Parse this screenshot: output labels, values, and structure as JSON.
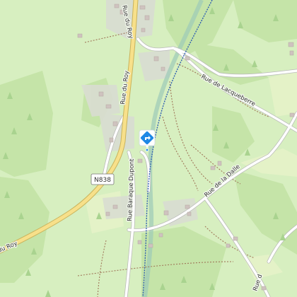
{
  "map": {
    "roads": [
      {
        "id": "rue-du-roy-north",
        "label": "Rue du Roy"
      },
      {
        "id": "rue-du-roy-south",
        "label": "du Roy"
      },
      {
        "id": "rue-de-lacqueberre",
        "label": "Rue de Lacqueberre"
      },
      {
        "id": "rue-de-la-dalle",
        "label": "Rue de la Dalle"
      },
      {
        "id": "rue-baraque-dupont",
        "label": "Rue Baraque Dupont"
      },
      {
        "id": "rue-d-east",
        "label": "Rue d"
      }
    ],
    "route_shield": {
      "label": "N838"
    },
    "marker": {
      "icon": "directions-diamond-icon",
      "color": "#1e88e5"
    },
    "colors": {
      "background": "#d7efc0",
      "forest": "#c6e5ab",
      "meadow": "#e6f3c8",
      "major_road": "#f7e08a",
      "major_road_casing": "#c9b35c",
      "minor_road": "#ffffff",
      "railway": "#2f5fb0",
      "path": "#a0785a",
      "building": "#d4c9c4",
      "residential": "#d9dcd4",
      "stream": "#a7c7dc"
    }
  }
}
